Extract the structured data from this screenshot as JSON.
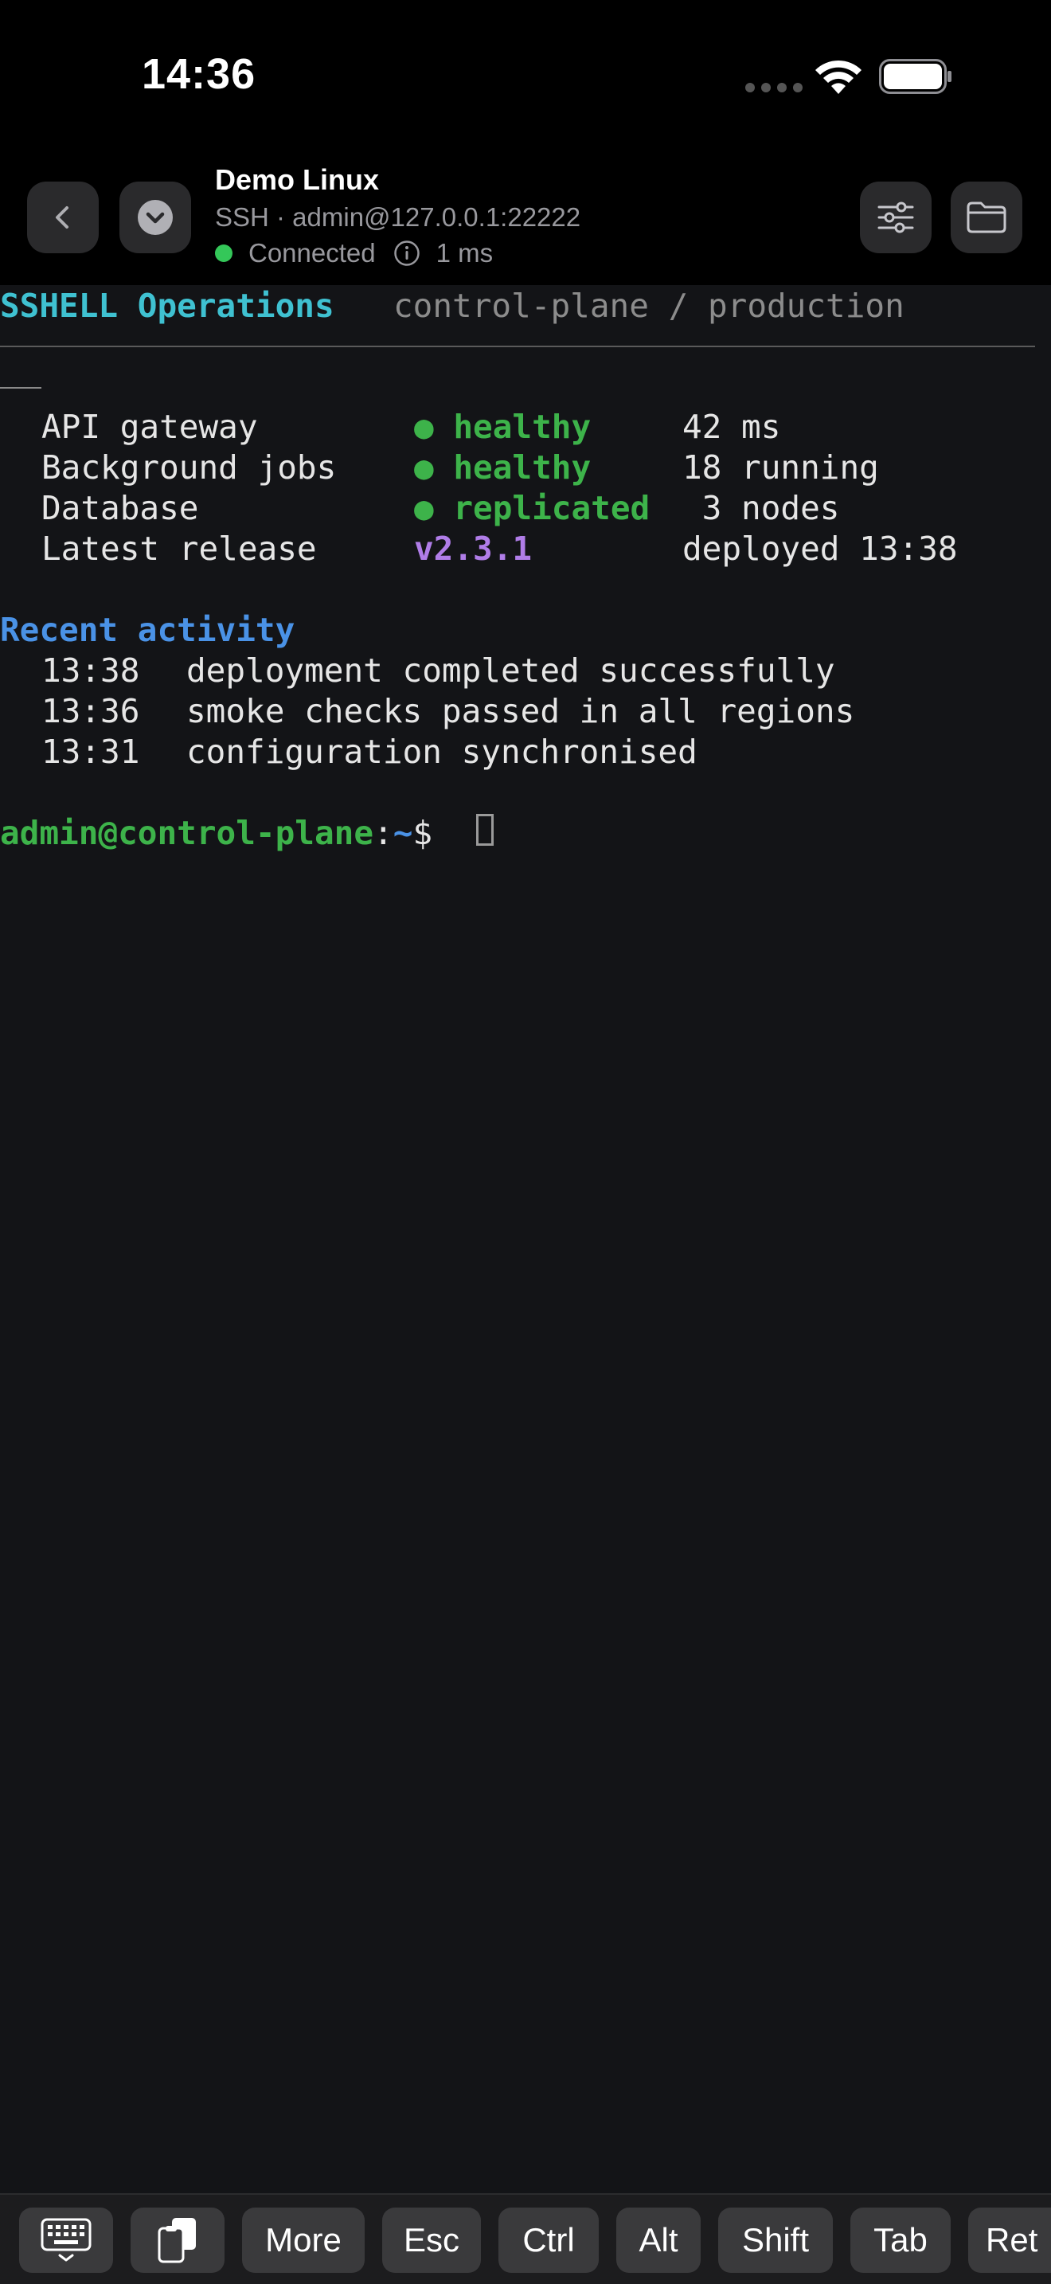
{
  "status_bar": {
    "time": "14:36"
  },
  "header": {
    "title": "Demo Linux",
    "subtitle": "SSH · admin@127.0.0.1:22222",
    "connection_status": "Connected",
    "latency": "1 ms",
    "status_color": "#34c759"
  },
  "terminal": {
    "tab_title": "SSHELL Operations",
    "tab_path": "control-plane / production",
    "services": [
      {
        "name": "API gateway",
        "status": "● healthy",
        "detail": "42 ms"
      },
      {
        "name": "Background jobs",
        "status": "● healthy",
        "detail": "18 running"
      },
      {
        "name": "Database",
        "status": "● replicated",
        "detail": " 3 nodes"
      },
      {
        "name": "Latest release",
        "status": "v2.3.1",
        "detail": "deployed 13:38"
      }
    ],
    "activity_heading": "Recent activity",
    "activity": [
      {
        "time": "13:38",
        "message": "deployment completed successfully"
      },
      {
        "time": "13:36",
        "message": "smoke checks passed in all regions"
      },
      {
        "time": "13:31",
        "message": "configuration synchronised"
      }
    ],
    "prompt_user": "admin@control-plane",
    "prompt_sep": ":",
    "prompt_path": "~",
    "prompt_symbol": "$"
  },
  "keyboard_bar": {
    "keys": [
      "More",
      "Esc",
      "Ctrl",
      "Alt",
      "Shift",
      "Tab",
      "Ret"
    ]
  },
  "icons": {
    "back": "chevron-left-icon",
    "menu": "chevron-down-circle-icon",
    "settings": "sliders-icon",
    "files": "folder-icon",
    "keyboard": "keyboard-icon",
    "clipboard": "clipboard-icon"
  },
  "colors": {
    "terminal_bg": "#131417",
    "title_cyan": "#3fc1d1",
    "ok_green": "#3db34a",
    "version_purple": "#b07de8",
    "section_blue": "#4a92e6"
  }
}
